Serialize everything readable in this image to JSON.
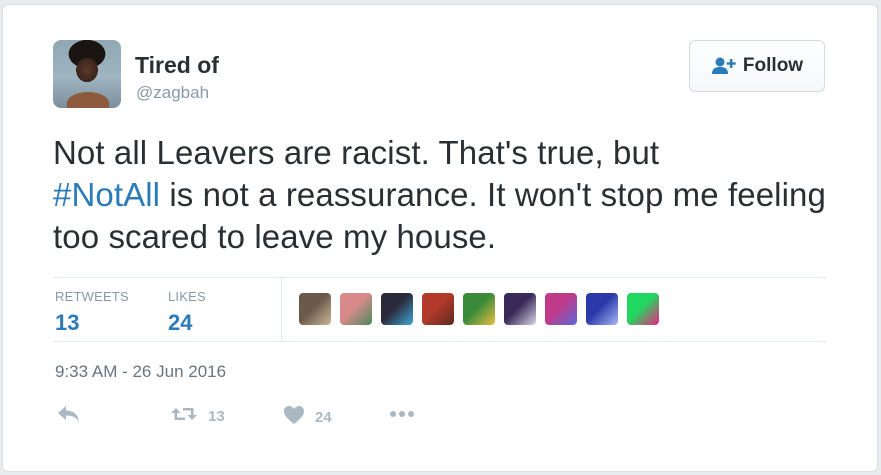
{
  "user": {
    "name": "Tired of",
    "handle": "@zagbah"
  },
  "follow_button": {
    "label": "Follow"
  },
  "tweet": {
    "text_part1": "Not all Leavers are racist. That's true, but",
    "hashtag": "#NotAll",
    "text_part2": " is not a reassurance. It won't stop me feeling too scared to leave my house."
  },
  "stats": {
    "retweets_label": "RETWEETS",
    "retweets_count": "13",
    "likes_label": "LIKES",
    "likes_count": "24"
  },
  "likers": [
    {
      "color_a": "#6b5a4a",
      "color_b": "#c9b79a"
    },
    {
      "color_a": "#d88a8a",
      "color_b": "#4a8a5a"
    },
    {
      "color_a": "#2a2a3a",
      "color_b": "#3fa9d8"
    },
    {
      "color_a": "#b33a2a",
      "color_b": "#5a2a20"
    },
    {
      "color_a": "#3a8a3a",
      "color_b": "#e8c040"
    },
    {
      "color_a": "#3a2a5a",
      "color_b": "#d8d8e8"
    },
    {
      "color_a": "#c03a8a",
      "color_b": "#5a6ad8"
    },
    {
      "color_a": "#2a3aa8",
      "color_b": "#a8b8f8"
    },
    {
      "color_a": "#20d860",
      "color_b": "#f02080"
    }
  ],
  "timestamp": "9:33 AM - 26 Jun 2016",
  "actions": {
    "reply_icon": "reply-icon",
    "retweet_count": "13",
    "like_count": "24",
    "more_icon": "more-icon"
  },
  "colors": {
    "link": "#2b7bb9",
    "text": "#292f33",
    "muted": "#8899a6",
    "action_icon": "#aab8c2"
  }
}
